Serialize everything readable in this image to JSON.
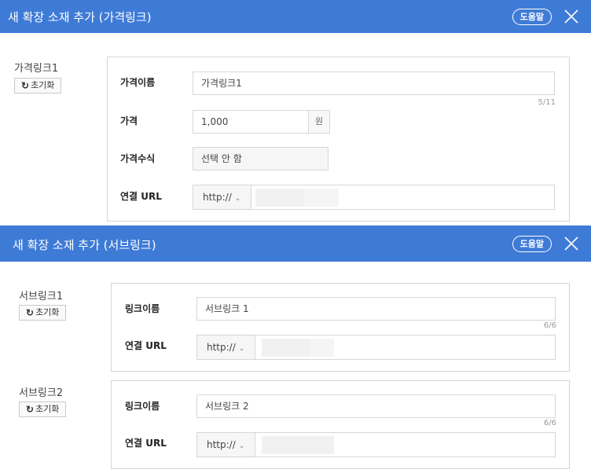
{
  "price_panel": {
    "title": "새 확장 소재 추가 (가격링크)",
    "help_label": "도움말",
    "item_label": "가격링크1",
    "reset_label": "초기화",
    "fields": {
      "name_label": "가격이름",
      "name_value": "가격링크1",
      "name_counter": "5/11",
      "price_label": "가격",
      "price_value": "1,000",
      "price_unit": "원",
      "modifier_label": "가격수식",
      "modifier_value": "선택 안 함",
      "url_label": "연결 URL",
      "url_protocol": "http://"
    }
  },
  "sublink_panel": {
    "title": "새 확장 소재 추가 (서브링크)",
    "help_label": "도움말",
    "items": [
      {
        "item_label": "서브링크1",
        "reset_label": "초기화",
        "name_label": "링크이름",
        "name_value": "서브링크 1",
        "name_counter": "6/6",
        "url_label": "연결 URL",
        "url_protocol": "http://"
      },
      {
        "item_label": "서브링크2",
        "reset_label": "초기화",
        "name_label": "링크이름",
        "name_value": "서브링크 2",
        "name_counter": "6/6",
        "url_label": "연결 URL",
        "url_protocol": "http://"
      }
    ]
  },
  "icons": {
    "reset": "↻",
    "close": "close-icon",
    "dropdown": "chevron-down-icon"
  },
  "colors": {
    "header": "#3e7bd6",
    "border": "#d5d5d5"
  }
}
